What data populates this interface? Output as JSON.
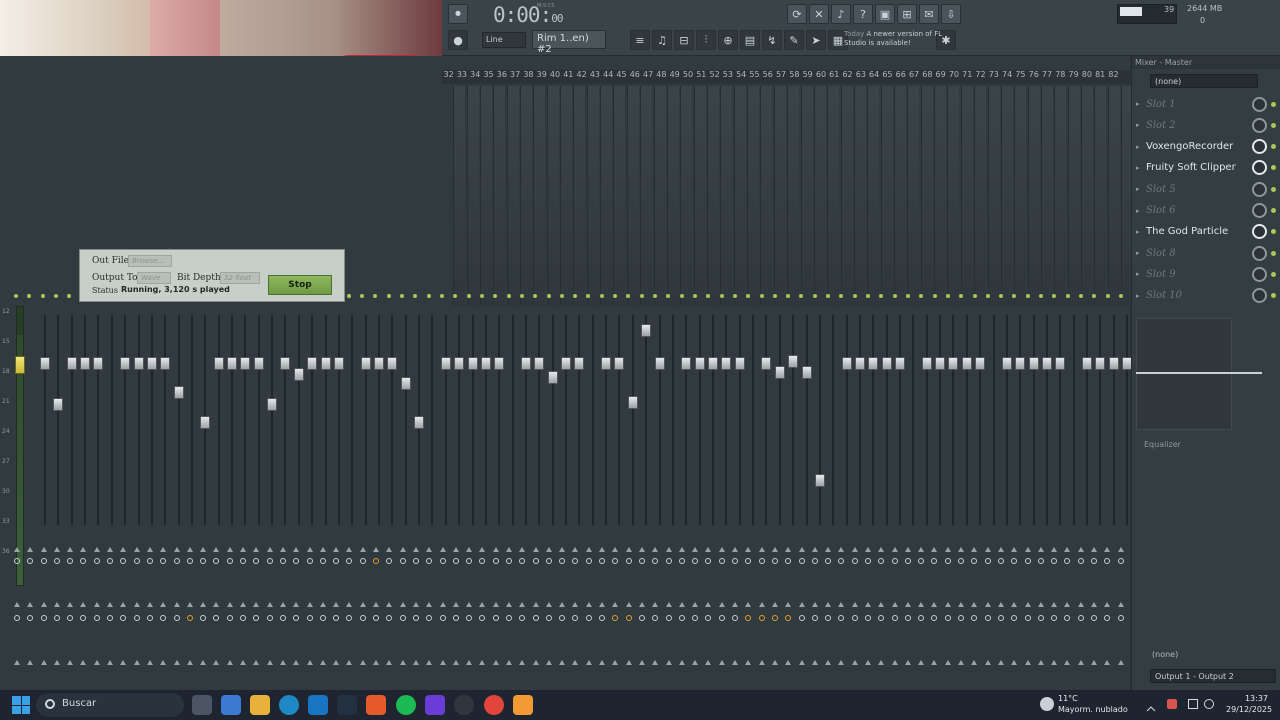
{
  "toolbar": {
    "time_main": "0:00:",
    "time_sub": "00",
    "time_unit": "M:S:CS",
    "cpu_value": "39",
    "memory": "2644 MB",
    "poly": "0",
    "line_mode": "Line",
    "pattern": "Rim 1..en) #2",
    "news_today": "Today",
    "news_text": "A newer version of FL Studio is available!"
  },
  "mixer": {
    "insert_numbers": [
      "32",
      "33",
      "34",
      "35",
      "36",
      "37",
      "38",
      "39",
      "40",
      "41",
      "42",
      "43",
      "44",
      "45",
      "46",
      "47",
      "48",
      "49",
      "50",
      "51",
      "52",
      "53",
      "54",
      "55",
      "56",
      "57",
      "58",
      "59",
      "60",
      "61",
      "62",
      "63",
      "64",
      "65",
      "66",
      "67",
      "68",
      "69",
      "70",
      "71",
      "72",
      "73",
      "74",
      "75",
      "76",
      "77",
      "78",
      "79",
      "80",
      "81",
      "82"
    ],
    "db_scale": [
      "12",
      "15",
      "18",
      "21",
      "24",
      "27",
      "30",
      "33",
      "36"
    ]
  },
  "render_dialog": {
    "out_file_label": "Out File",
    "browse_label": "Browse...",
    "output_to_label": "Output To",
    "output_to_value": "Wave",
    "bit_depth_label": "Bit Depth",
    "bit_depth_value": "32 float",
    "status_label": "Status",
    "status_value": "Running, 3,120 s played",
    "stop_label": "Stop"
  },
  "right_panel": {
    "title": "Mixer - Master",
    "preset": "(none)",
    "slots": [
      {
        "name": "Slot 1",
        "empty": true
      },
      {
        "name": "Slot 2",
        "empty": true
      },
      {
        "name": "VoxengoRecorder",
        "empty": false
      },
      {
        "name": "Fruity Soft Clipper",
        "empty": false
      },
      {
        "name": "Slot 5",
        "empty": true
      },
      {
        "name": "Slot 6",
        "empty": true
      },
      {
        "name": "The God Particle",
        "empty": false
      },
      {
        "name": "Slot 8",
        "empty": true
      },
      {
        "name": "Slot 9",
        "empty": true
      },
      {
        "name": "Slot 10",
        "empty": true
      }
    ],
    "eq_label": "Equalizer",
    "bottom_preset": "(none)",
    "output": "Output 1 - Output 2"
  },
  "taskbar": {
    "search_placeholder": "Buscar",
    "weather_temp": "11°C",
    "weather_desc": "Mayorm. nublado",
    "time": "13:37",
    "date": "29/12/2025"
  },
  "colors": {
    "accent_green": "#a6c95b",
    "stop_button": "#7fa952",
    "orange": "#e39b2b"
  },
  "icons": [
    "search-icon",
    "windows-start-icon",
    "record-icon",
    "metronome-icon",
    "mic-icon",
    "help-icon",
    "save-icon",
    "gear-icon"
  ]
}
